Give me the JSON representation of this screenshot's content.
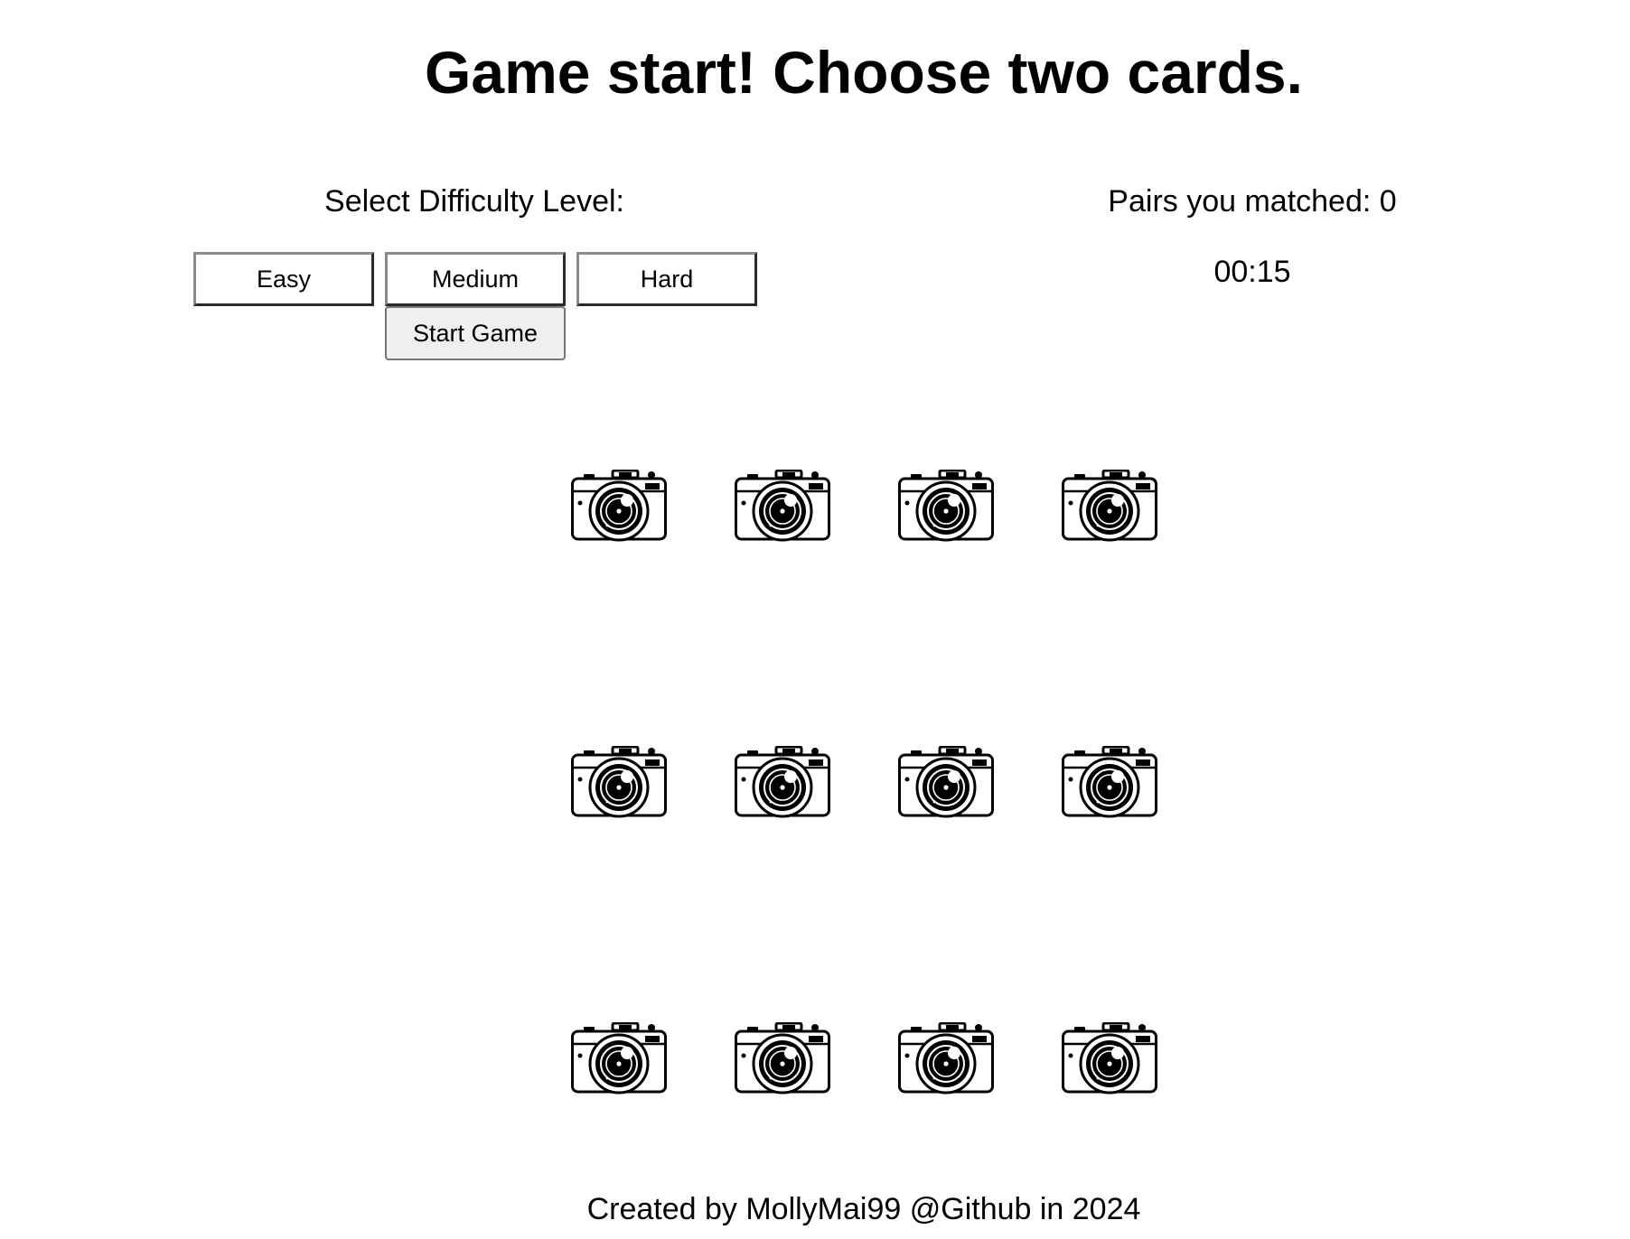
{
  "header": {
    "title": "Game start! Choose two cards."
  },
  "difficulty": {
    "label": "Select Difficulty Level:",
    "options": [
      "Easy",
      "Medium",
      "Hard"
    ],
    "start_label": "Start Game"
  },
  "status": {
    "pairs_label": "Pairs you matched: 0",
    "pairs_matched": 0,
    "timer": "00:15"
  },
  "board": {
    "rows": 3,
    "columns": 4,
    "card_back_icon": "camera-icon",
    "card_count": 12
  },
  "footer": {
    "credit": "Created by MollyMai99 @Github in 2024"
  }
}
